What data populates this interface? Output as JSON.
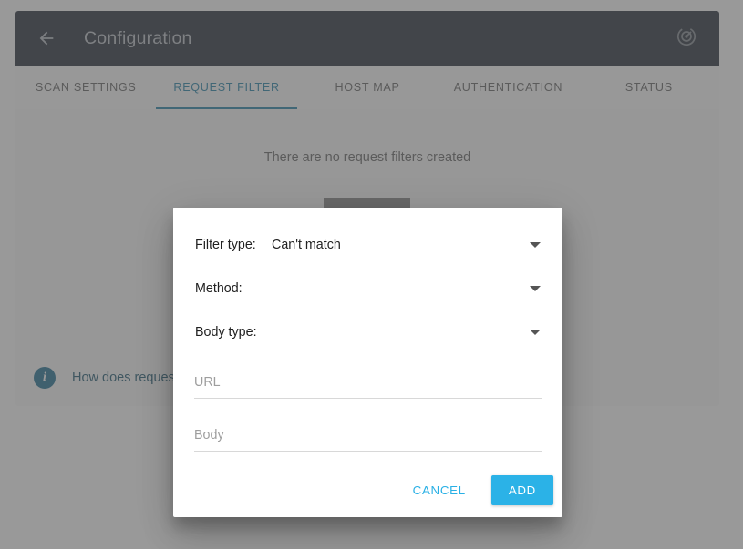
{
  "appbar": {
    "back_icon": "arrow-left-icon",
    "title": "Configuration",
    "action_icon": "radar-scan-icon"
  },
  "tabs": [
    {
      "label": "SCAN SETTINGS",
      "active": false
    },
    {
      "label": "REQUEST FILTER",
      "active": true
    },
    {
      "label": "HOST MAP",
      "active": false
    },
    {
      "label": "AUTHENTICATION",
      "active": false
    },
    {
      "label": "STATUS",
      "active": false
    }
  ],
  "content": {
    "empty_message": "There are no request filters created"
  },
  "info": {
    "icon": "info-icon",
    "glyph": "i",
    "text": "How does request filter"
  },
  "fab": {
    "icon": "plus-icon",
    "label": "+"
  },
  "dialog": {
    "filter_type": {
      "label": "Filter type:",
      "value": "Can't match",
      "caret_icon": "chevron-down-icon"
    },
    "method": {
      "label": "Method:",
      "value": "",
      "caret_icon": "chevron-down-icon"
    },
    "body_type": {
      "label": "Body type:",
      "value": "",
      "caret_icon": "chevron-down-icon"
    },
    "url_field": {
      "placeholder": "URL",
      "value": ""
    },
    "body_field": {
      "placeholder": "Body",
      "value": ""
    },
    "cancel_label": "CANCEL",
    "add_label": "ADD"
  },
  "colors": {
    "appbar_bg": "#1c2430",
    "accent_blue": "#1a7ba4",
    "button_blue": "#2bb2e7",
    "fab_green": "#17702f",
    "info_blue": "#17698f",
    "scrim": "#979797"
  }
}
